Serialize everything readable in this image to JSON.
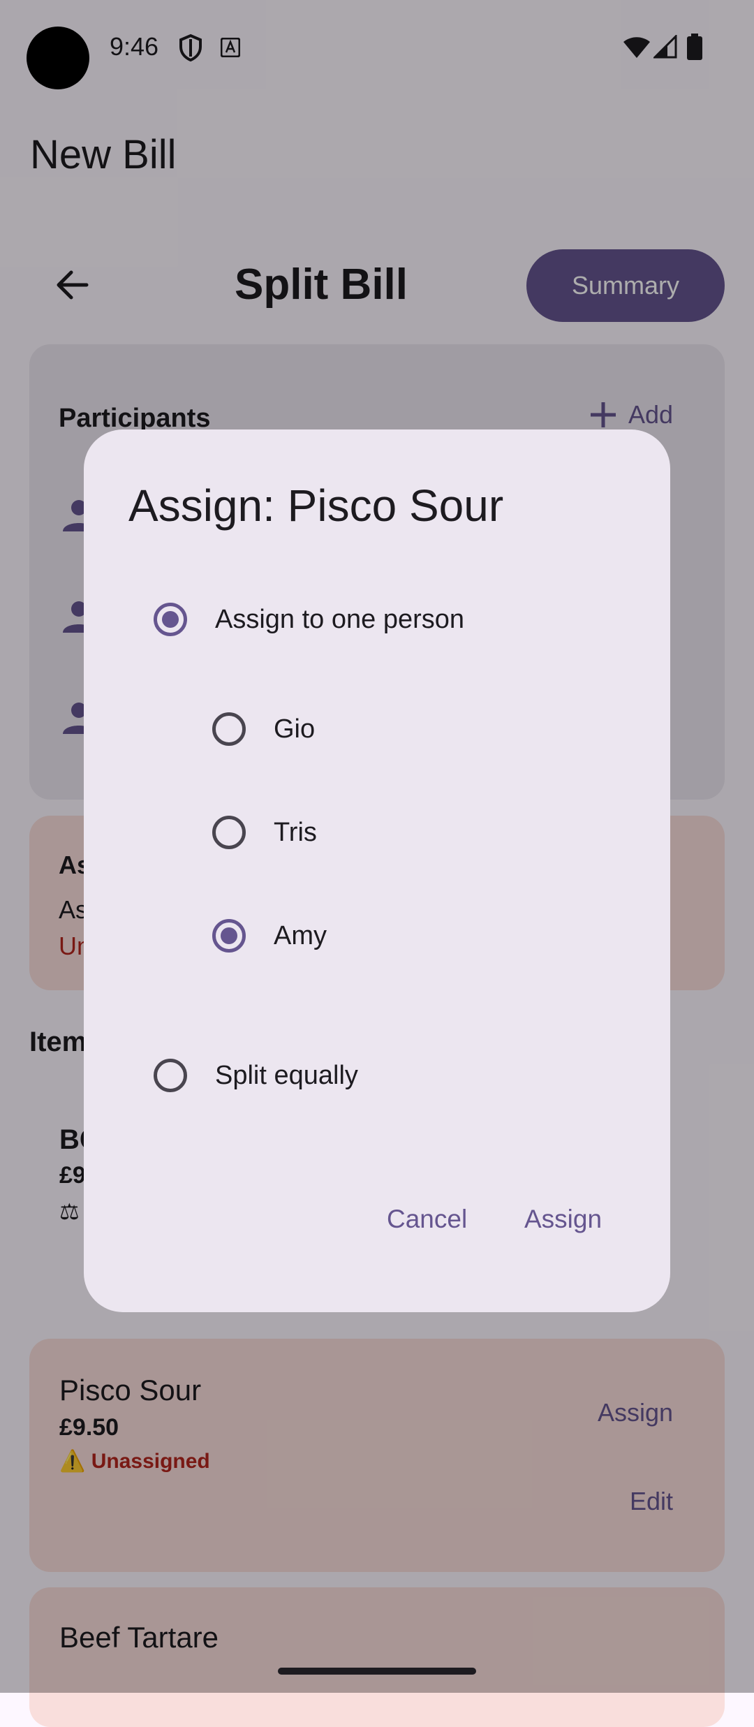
{
  "status_bar": {
    "time": "9:46"
  },
  "app": {
    "title": "New Bill"
  },
  "toolbar": {
    "title": "Split Bill",
    "summary_label": "Summary"
  },
  "participants": {
    "title": "Participants",
    "add_label": "Add"
  },
  "warning": {
    "title": "As",
    "line1": "As",
    "line2": "Un"
  },
  "items_section": {
    "title": "Item",
    "items": [
      {
        "name": "BC",
        "price": "£9"
      }
    ]
  },
  "pisco_card": {
    "name": "Pisco Sour",
    "price": "£9.50",
    "status": "Unassigned",
    "assign_label": "Assign",
    "edit_label": "Edit"
  },
  "beef_card": {
    "name": "Beef Tartare"
  },
  "dialog": {
    "title": "Assign: Pisco Sour",
    "options": {
      "one_person": "Assign to one person",
      "split_equally": "Split equally"
    },
    "people": [
      "Gio",
      "Tris",
      "Amy"
    ],
    "selected_mode": "one_person",
    "selected_person": "Amy",
    "cancel_label": "Cancel",
    "assign_label": "Assign"
  },
  "colors": {
    "primary": "#65558f",
    "error": "#b3261e",
    "surface": "#fdf7ff",
    "dialog_surface": "#ece6f0",
    "error_container": "#f9dedc"
  }
}
